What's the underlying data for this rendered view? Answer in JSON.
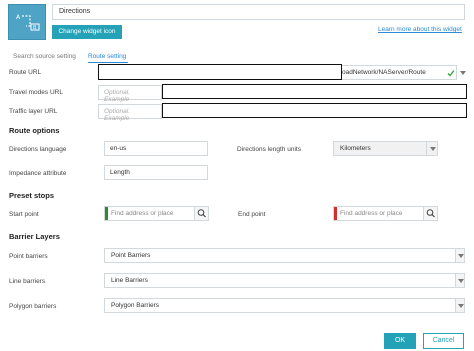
{
  "header": {
    "widget_name": "Directions",
    "change_icon_label": "Change widget icon",
    "learn_more": "Learn more about this widget"
  },
  "tabs": [
    "Search source setting",
    "Route setting"
  ],
  "route": {
    "route_url_label": "Route URL",
    "route_url_value": "oadNetwork/NAServer/Route",
    "travel_modes_label": "Travel modes URL",
    "travel_modes_placeholder": "Optional. Example",
    "traffic_layer_label": "Traffic layer URL",
    "traffic_layer_placeholder": "Optional. Example"
  },
  "route_options": {
    "title": "Route options",
    "language_label": "Directions language",
    "language_value": "en-us",
    "length_units_label": "Directions length units",
    "length_units_value": "Kilometers",
    "impedance_label": "Impedance attribute",
    "impedance_value": "Length"
  },
  "preset_stops": {
    "title": "Preset stops",
    "start_label": "Start point",
    "start_placeholder": "Find address or place",
    "end_label": "End point",
    "end_placeholder": "Find address or place",
    "start_color": "#2e8b2e",
    "end_color": "#d32f2f"
  },
  "barriers": {
    "title": "Barrier Layers",
    "point_label": "Point barriers",
    "point_value": "Point Barriers",
    "line_label": "Line barriers",
    "line_value": "Line Barriers",
    "polygon_label": "Polygon barriers",
    "polygon_value": "Polygon Barriers"
  },
  "footer": {
    "ok": "OK",
    "cancel": "Cancel"
  },
  "colors": {
    "accent": "#24a3b8",
    "link": "#2b8bd6",
    "icon_bg": "#4fa3c4",
    "check": "#3aa33a"
  },
  "icons": [
    "directions-icon",
    "check-icon",
    "search-icon",
    "chevron-down-icon"
  ]
}
